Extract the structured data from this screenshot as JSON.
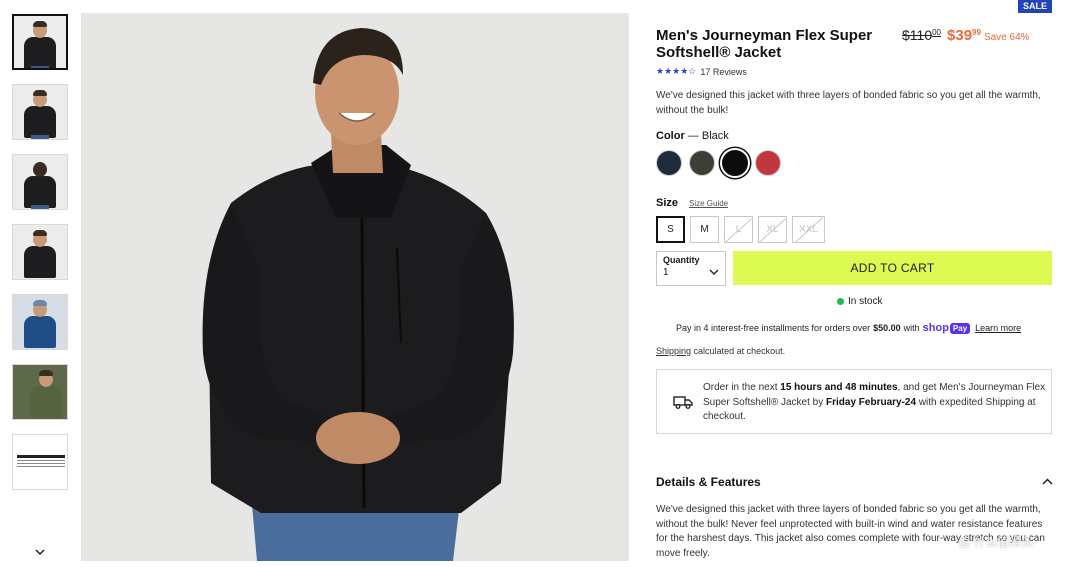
{
  "product": {
    "badge": "SALE",
    "title": "Men's Journeyman Flex Super Softshell® Jacket",
    "old_price_main": "$110",
    "old_price_cents": "00",
    "new_price_main": "$39",
    "new_price_cents": "99",
    "save_text": "Save 64%",
    "rating_stars": 4,
    "reviews": "17 Reviews",
    "short_description": "We've designed this jacket with three layers of bonded fabric so you get all the warmth, without the bulk!"
  },
  "gallery": {
    "thumbnails": [
      "front view",
      "open jacket",
      "back view",
      "side profile",
      "blue colorway",
      "green colorway",
      "size chart"
    ],
    "active_index": 0
  },
  "color": {
    "label": "Color",
    "selected": "Black",
    "swatches": [
      {
        "name": "Navy",
        "hex": "#202b3e"
      },
      {
        "name": "Olive",
        "hex": "#3b3f36"
      },
      {
        "name": "Black",
        "hex": "#0c0c0c"
      },
      {
        "name": "Red",
        "hex": "#c0373f"
      }
    ]
  },
  "size": {
    "label": "Size",
    "guide": "Size Guide",
    "options": [
      {
        "label": "S",
        "available": true,
        "selected": true
      },
      {
        "label": "M",
        "available": true,
        "selected": false
      },
      {
        "label": "L",
        "available": false,
        "selected": false
      },
      {
        "label": "XL",
        "available": false,
        "selected": false
      },
      {
        "label": "XXL",
        "available": false,
        "selected": false
      }
    ]
  },
  "quantity": {
    "label": "Quantity",
    "value": "1"
  },
  "cart": {
    "button": "ADD TO CART"
  },
  "stock": {
    "text": "In stock",
    "color": "#1db954"
  },
  "installments": {
    "prefix": "Pay in 4 interest-free installments for orders over",
    "amount": "$50.00",
    "with": "with",
    "shop": "shop",
    "pay": "Pay",
    "learn_more": "Learn more"
  },
  "shipping": {
    "link": "Shipping",
    "rest": "calculated at checkout."
  },
  "delivery": {
    "p1": "Order in the next",
    "time": "15 hours and 48 minutes",
    "p2": ", and get Men's Journeyman Flex Super Softshell® Jacket by",
    "date": "Friday February-24",
    "p3": "with expedited Shipping at checkout."
  },
  "details": {
    "heading": "Details & Features",
    "text": "We've designed this jacket with three layers of bonded fabric so you get all the warmth, without the bulk! Never feel unprotected with built-in wind and water resistance features for the harshest days. This jacket also comes complete with four-way stretch so you can move freely."
  },
  "watermark": "值 什么值得买",
  "colors": {
    "accent_price": "#f0683a",
    "cart_bg": "#dcfa51",
    "badge_bg": "#2343b8",
    "stars": "#2a45b8"
  }
}
